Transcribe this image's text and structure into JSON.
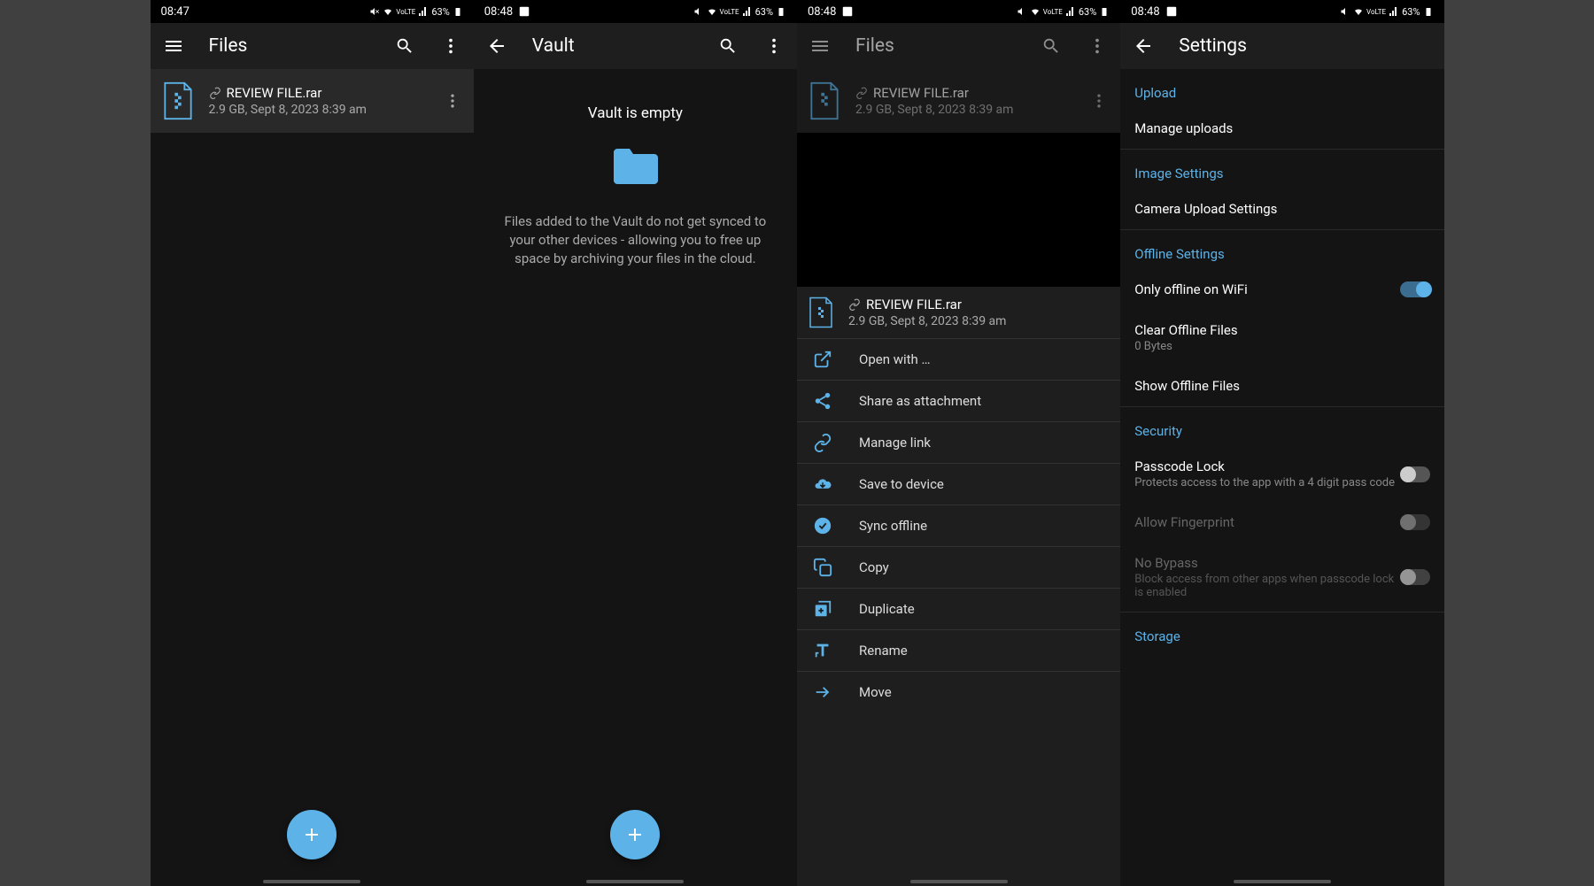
{
  "status": {
    "screen1": {
      "time": "08:47",
      "battery": "63%"
    },
    "screen2": {
      "time": "08:48",
      "battery": "63%"
    },
    "screen3": {
      "time": "08:48",
      "battery": "63%"
    },
    "screen4": {
      "time": "08:48",
      "battery": "63%"
    }
  },
  "screen1": {
    "title": "Files",
    "file": {
      "name": "REVIEW FILE.rar",
      "meta": "2.9 GB, Sept 8, 2023 8:39 am"
    }
  },
  "screen2": {
    "title": "Vault",
    "empty_title": "Vault is empty",
    "empty_desc": "Files added to the Vault do not get synced to your other devices - allowing you to free up space by archiving your files in the cloud."
  },
  "screen3": {
    "title": "Files",
    "file": {
      "name": "REVIEW FILE.rar",
      "meta": "2.9 GB, Sept 8, 2023 8:39 am"
    },
    "sheet_file": {
      "name": "REVIEW FILE.rar",
      "meta": "2.9 GB, Sept 8, 2023 8:39 am"
    },
    "menu": {
      "open_with": "Open with …",
      "share": "Share as attachment",
      "manage_link": "Manage link",
      "save": "Save to device",
      "sync": "Sync offline",
      "copy": "Copy",
      "duplicate": "Duplicate",
      "rename": "Rename",
      "move": "Move"
    }
  },
  "screen4": {
    "title": "Settings",
    "sections": {
      "upload": "Upload",
      "image": "Image Settings",
      "offline": "Offline Settings",
      "security": "Security",
      "storage": "Storage"
    },
    "items": {
      "manage_uploads": "Manage uploads",
      "camera_upload": "Camera Upload Settings",
      "only_wifi": "Only offline on WiFi",
      "clear_offline": "Clear Offline Files",
      "clear_offline_desc": "0 Bytes",
      "show_offline": "Show Offline Files",
      "passcode": "Passcode Lock",
      "passcode_desc": "Protects access to the app with a 4 digit pass code",
      "fingerprint": "Allow Fingerprint",
      "no_bypass": "No Bypass",
      "no_bypass_desc": "Block access from other apps when passcode lock is enabled"
    }
  }
}
